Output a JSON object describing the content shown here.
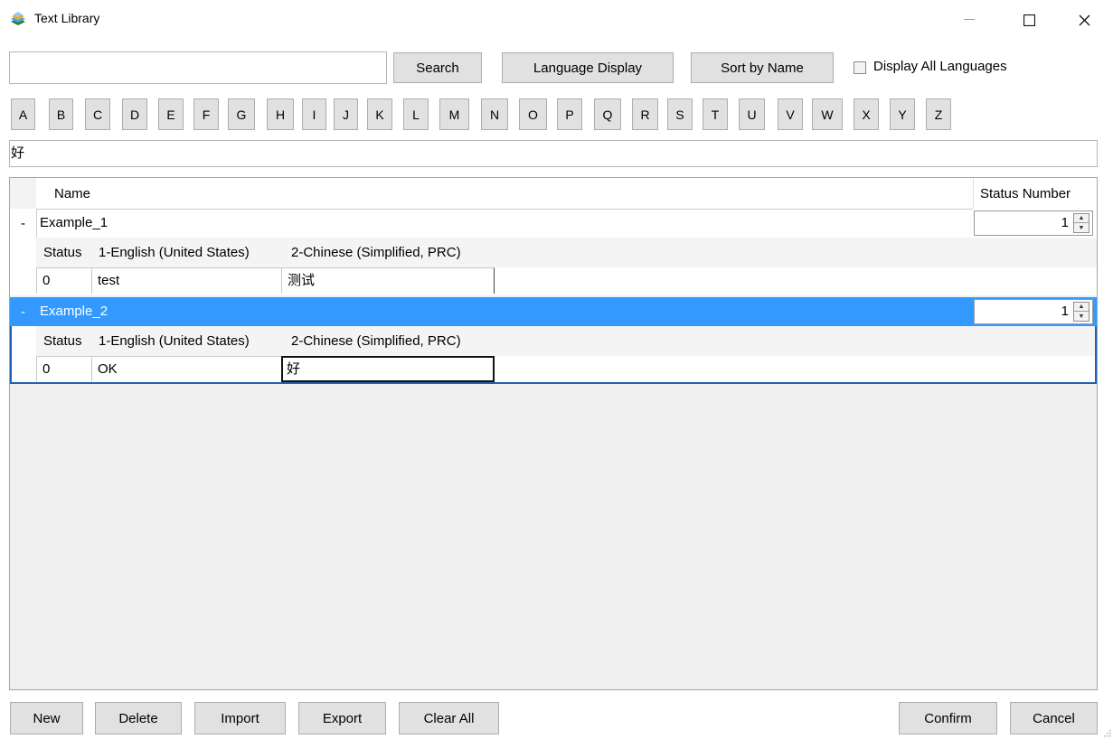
{
  "window": {
    "title": "Text Library",
    "icon": "app-icon",
    "controls": {
      "minimize": "—",
      "maximize": "☐",
      "close": "✕"
    }
  },
  "toolbar": {
    "search_value": "",
    "search_label": "Search",
    "language_display_label": "Language Display",
    "sort_label": "Sort by Name",
    "display_all_checked": false,
    "display_all_label": "Display All Languages"
  },
  "letters": [
    "A",
    "B",
    "C",
    "D",
    "E",
    "F",
    "G",
    "H",
    "I",
    "J",
    "K",
    "L",
    "M",
    "N",
    "O",
    "P",
    "Q",
    "R",
    "S",
    "T",
    "U",
    "V",
    "W",
    "X",
    "Y",
    "Z"
  ],
  "filter_value": "好",
  "grid": {
    "headers": {
      "name": "Name",
      "status_number": "Status Number"
    },
    "rows": [
      {
        "expander": "-",
        "name": "Example_1",
        "status_number": "1",
        "selected": false,
        "child_headers": [
          "Status",
          "1-English (United States)",
          "2-Chinese (Simplified, PRC)"
        ],
        "child_values": [
          "0",
          "test",
          "测试"
        ]
      },
      {
        "expander": "-",
        "name": "Example_2",
        "status_number": "1",
        "selected": true,
        "child_headers": [
          "Status",
          "1-English (United States)",
          "2-Chinese (Simplified, PRC)"
        ],
        "child_values": [
          "0",
          "OK",
          "好"
        ]
      }
    ]
  },
  "footer": {
    "new_label": "New",
    "delete_label": "Delete",
    "import_label": "Import",
    "export_label": "Export",
    "clear_all_label": "Clear All",
    "confirm_label": "Confirm",
    "cancel_label": "Cancel"
  },
  "colors": {
    "selection": "#3399ff",
    "button_face": "#e1e1e1",
    "grid_border": "#8fa9c9"
  }
}
